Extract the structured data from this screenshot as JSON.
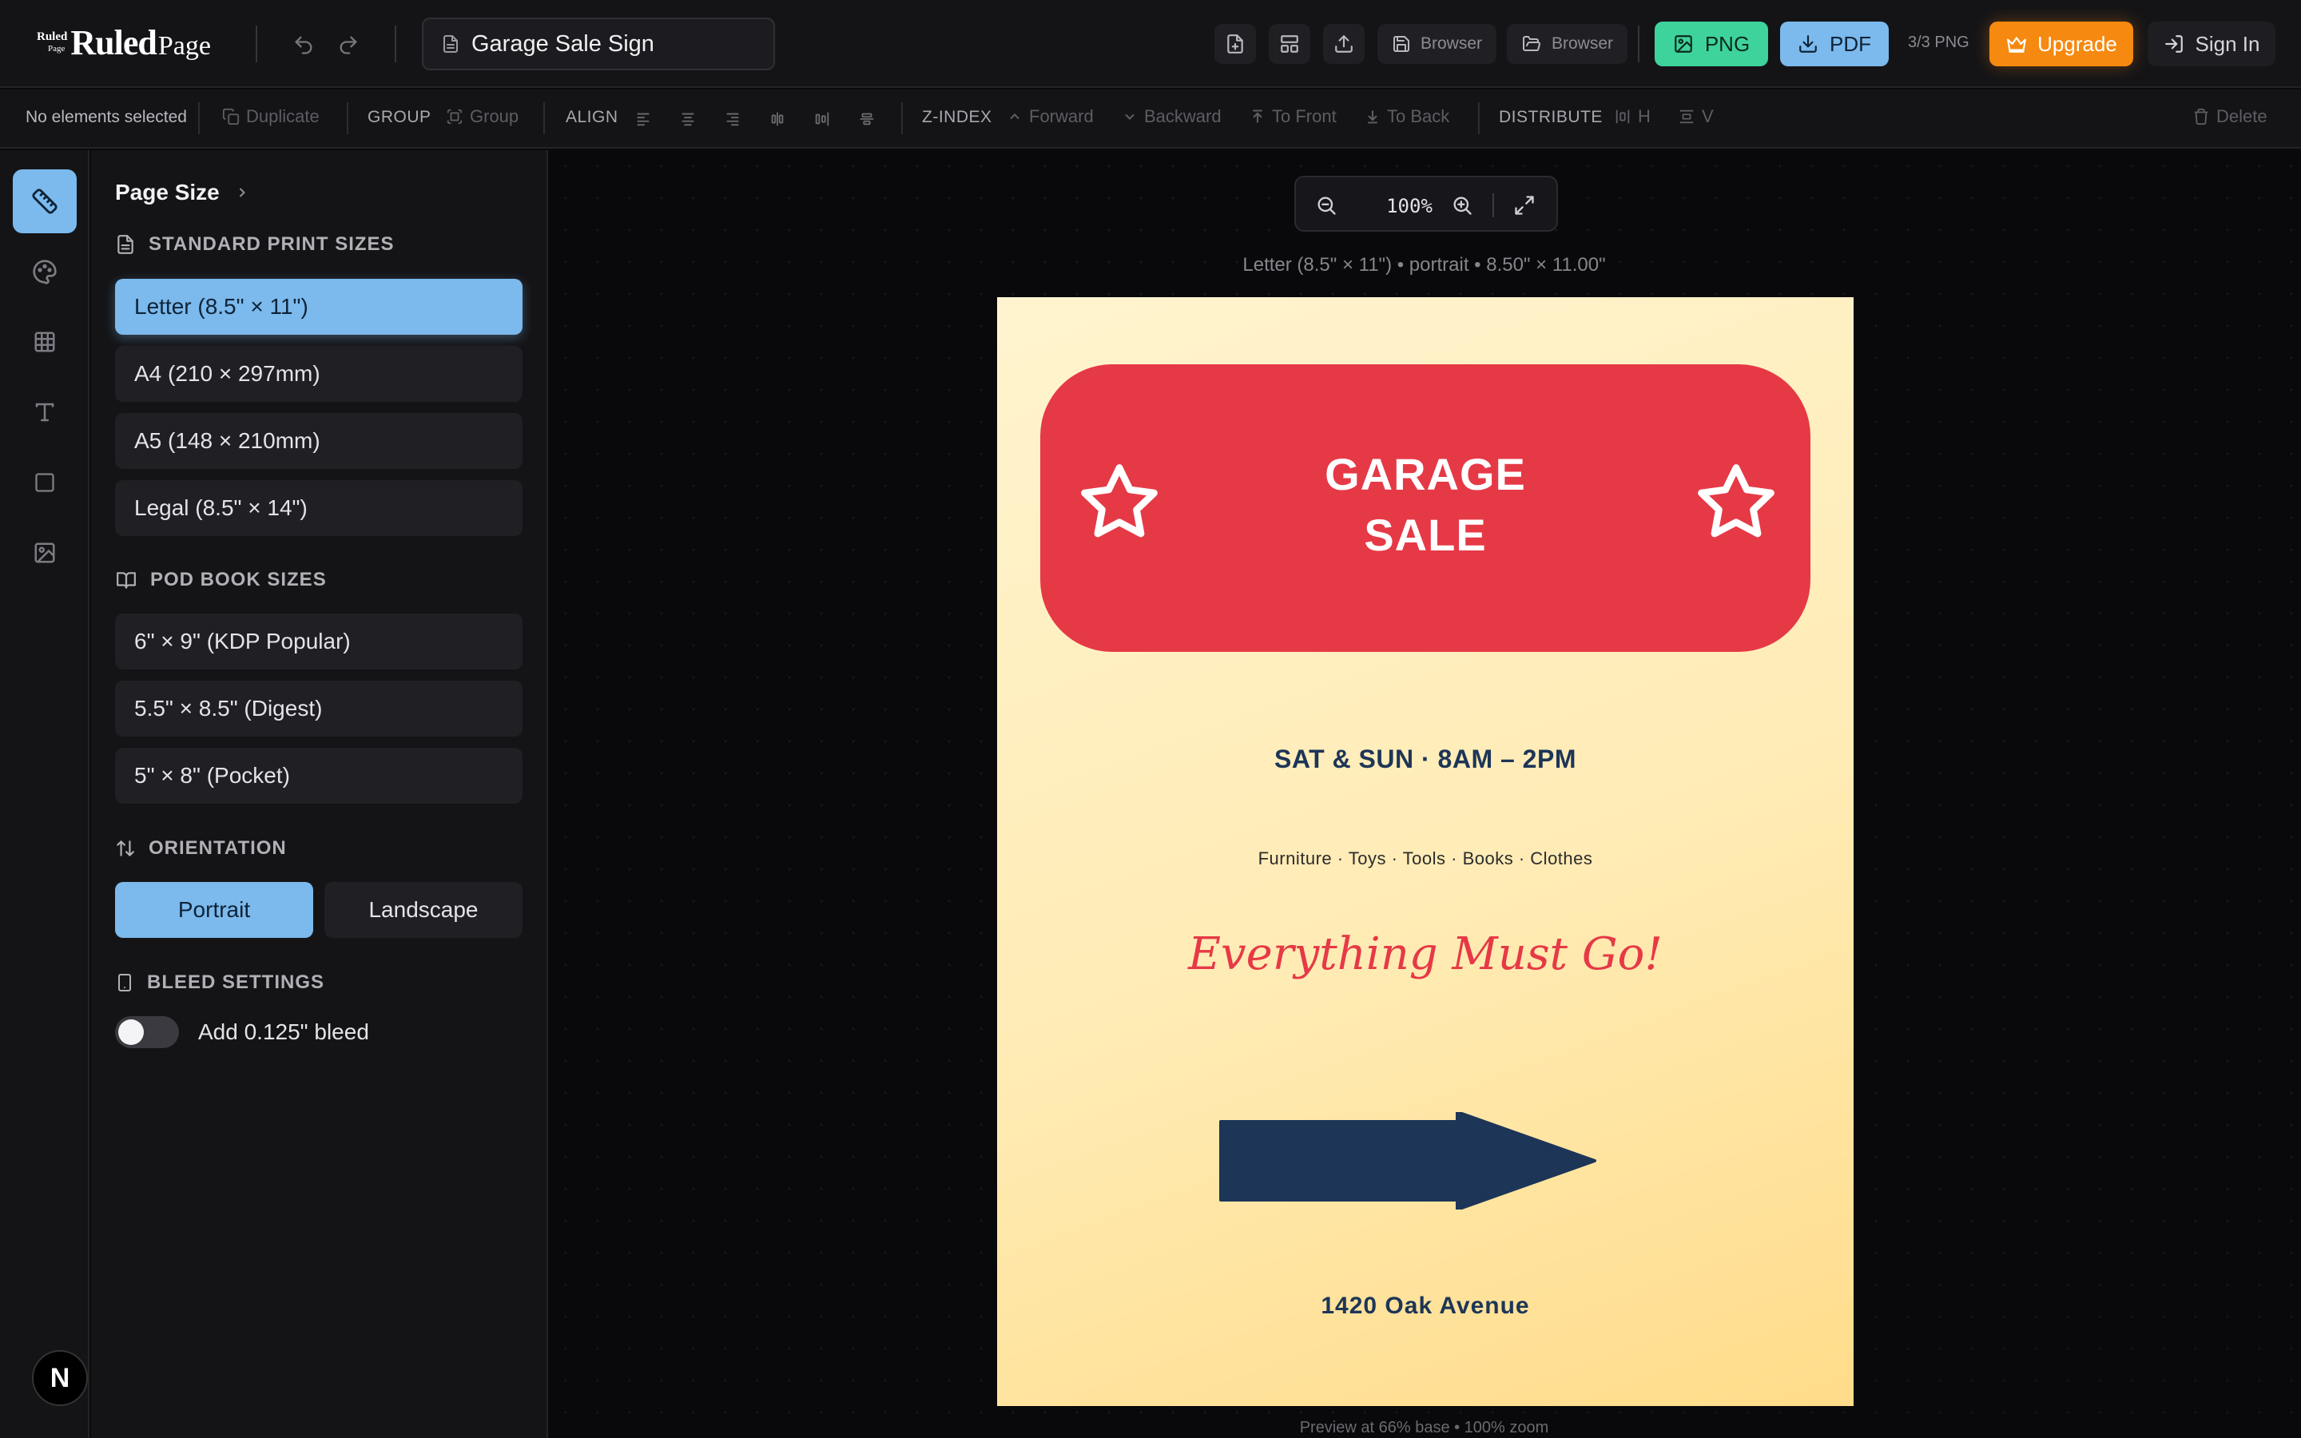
{
  "app": {
    "logo_mini_top": "Ruled",
    "logo_mini_bottom": "Page",
    "logo_main": "Ruled",
    "logo_sub": "Page",
    "document_title": "Garage Sale Sign"
  },
  "topbar": {
    "save_label": "Browser",
    "open_label": "Browser",
    "png_label": "PNG",
    "pdf_label": "PDF",
    "export_count": "3/3 PNG",
    "upgrade_label": "Upgrade",
    "signin_label": "Sign In",
    "accent_png": "#3ed39b",
    "accent_pdf": "#7cb9ec",
    "accent_upgrade": "#f6890f"
  },
  "toolbar": {
    "selection_status": "No elements selected",
    "duplicate_label": "Duplicate",
    "group_section": "GROUP",
    "group_label": "Group",
    "align_section": "ALIGN",
    "zindex_section": "Z-INDEX",
    "forward_label": "Forward",
    "backward_label": "Backward",
    "to_front_label": "To Front",
    "to_back_label": "To Back",
    "distribute_section": "DISTRIBUTE",
    "dist_h_label": "H",
    "dist_v_label": "V",
    "delete_label": "Delete"
  },
  "panel": {
    "title": "Page Size",
    "standard_heading": "STANDARD PRINT SIZES",
    "standard_sizes": [
      "Letter (8.5\" × 11\")",
      "A4 (210 × 297mm)",
      "A5 (148 × 210mm)",
      "Legal (8.5\" × 14\")"
    ],
    "pod_heading": "POD BOOK SIZES",
    "pod_sizes": [
      "6\" × 9\" (KDP Popular)",
      "5.5\" × 8.5\" (Digest)",
      "5\" × 8\" (Pocket)"
    ],
    "orientation_heading": "ORIENTATION",
    "portrait_label": "Portrait",
    "landscape_label": "Landscape",
    "bleed_heading": "BLEED SETTINGS",
    "bleed_label": "Add 0.125\" bleed"
  },
  "canvas": {
    "zoom_value": "100%",
    "page_info": "Letter (8.5\" × 11\") • portrait • 8.50\" × 11.00\"",
    "preview_note": "Preview at 66% base • 100% zoom"
  },
  "sign": {
    "title_line1": "GARAGE",
    "title_line2": "SALE",
    "dates": "SAT & SUN · 8AM – 2PM",
    "items": "Furniture · Toys · Tools · Books · Clothes",
    "slogan": "Everything Must Go!",
    "address": "1420 Oak Avenue",
    "color_red": "#e63946",
    "color_navy": "#1d3557"
  },
  "rail": {
    "badge_letter": "N"
  }
}
